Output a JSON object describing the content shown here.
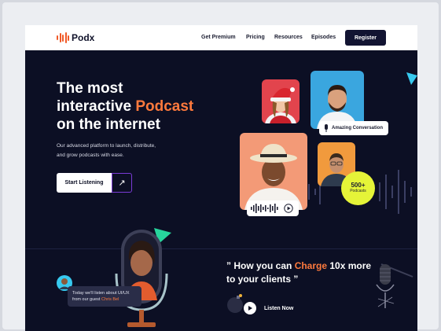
{
  "brand": {
    "name": "Podx",
    "accent": "#f05a28"
  },
  "nav": {
    "links": [
      "Get Premium",
      "Pricing",
      "Resources",
      "Episodes"
    ],
    "register": "Register"
  },
  "hero": {
    "line1": "The most",
    "line2_before": "interactive ",
    "line2_accent": "Podcast",
    "line3": "on the internet",
    "sub_line1": "Our advanced platform to launch, distribute,",
    "sub_line2": "and grow podcasts with ease.",
    "cta": "Start Listening",
    "cta_arrow": "↗"
  },
  "chips": {
    "conversation": "Amazing Conversation",
    "count": "500+",
    "count_label": "Podcasts"
  },
  "quote": {
    "open": "” How you can ",
    "accent": "Charge",
    "rest": " 10x more to your clients ”",
    "listen": "Listen Now"
  },
  "message": {
    "text": "Today we'll listen about UI/UX from our guest ",
    "guest": "Chris Bel"
  },
  "colors": {
    "bg": "#0c0f24",
    "accent": "#ff7a3d",
    "lime": "#e5f438",
    "cyan": "#37c9ef",
    "teal": "#27d49c"
  }
}
